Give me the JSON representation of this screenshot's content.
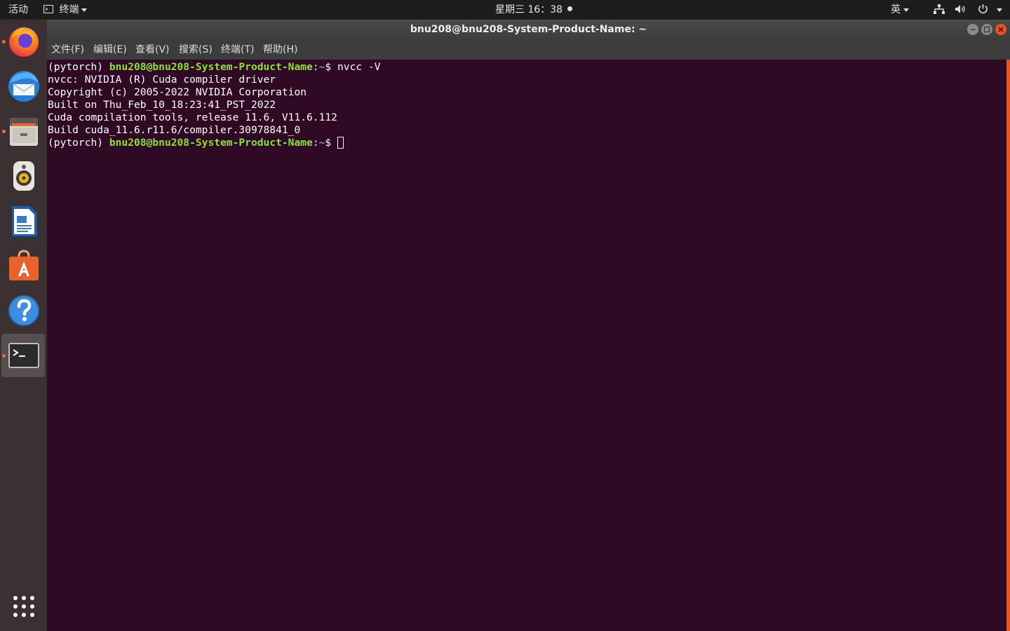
{
  "topbar": {
    "activities": "活动",
    "app_name": "终端",
    "clock": "星期三 16：38",
    "input_method": "英"
  },
  "dock": {
    "items": [
      {
        "name": "firefox",
        "running": true
      },
      {
        "name": "thunderbird",
        "running": false
      },
      {
        "name": "files",
        "running": true
      },
      {
        "name": "rhythmbox",
        "running": false
      },
      {
        "name": "libreoffice-writer",
        "running": false
      },
      {
        "name": "ubuntu-software",
        "running": false
      },
      {
        "name": "help",
        "running": false
      },
      {
        "name": "terminal",
        "running": true,
        "active": true
      }
    ]
  },
  "window": {
    "title": "bnu208@bnu208-System-Product-Name: ~",
    "menu": [
      "文件(F)",
      "编辑(E)",
      "查看(V)",
      "搜索(S)",
      "终端(T)",
      "帮助(H)"
    ]
  },
  "terminal": {
    "prompt": {
      "env": "(pytorch) ",
      "user_host": "bnu208@bnu208-System-Product-Name",
      "sep": ":",
      "path": "~",
      "symbol": "$ "
    },
    "command": "nvcc -V",
    "output": [
      "nvcc: NVIDIA (R) Cuda compiler driver",
      "Copyright (c) 2005-2022 NVIDIA Corporation",
      "Built on Thu_Feb_10_18:23:41_PST_2022",
      "Cuda compilation tools, release 11.6, V11.6.112",
      "Build cuda_11.6.r11.6/compiler.30978841_0"
    ]
  },
  "colors": {
    "terminal_bg": "#300a24",
    "prompt_green": "#8ae234",
    "prompt_blue": "#729fcf",
    "accent_orange": "#e95420"
  }
}
